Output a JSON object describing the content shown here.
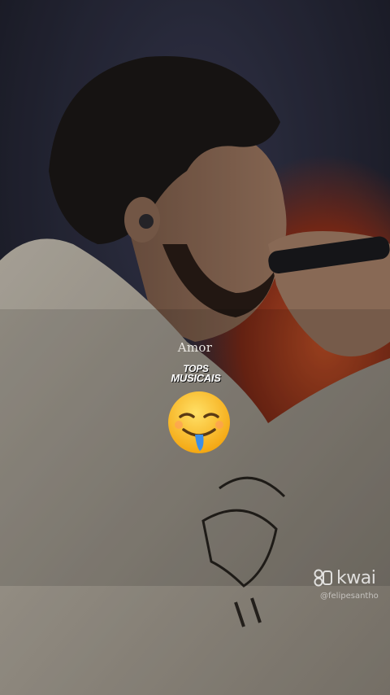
{
  "video": {
    "caption": "Amor",
    "logo_line1": "TOPS",
    "logo_line2": "MUSICAIS",
    "reaction_emoji_icon": "drooling-face-icon"
  },
  "watermark": {
    "brand": "kwai",
    "brand_icon": "kwai-camera-icon",
    "handle": "@felipesantho"
  },
  "colors": {
    "background": "#1e1f2a",
    "stage_light": "#c2451f",
    "jacket": "#b9b2a5",
    "hair": "#1c1816"
  }
}
